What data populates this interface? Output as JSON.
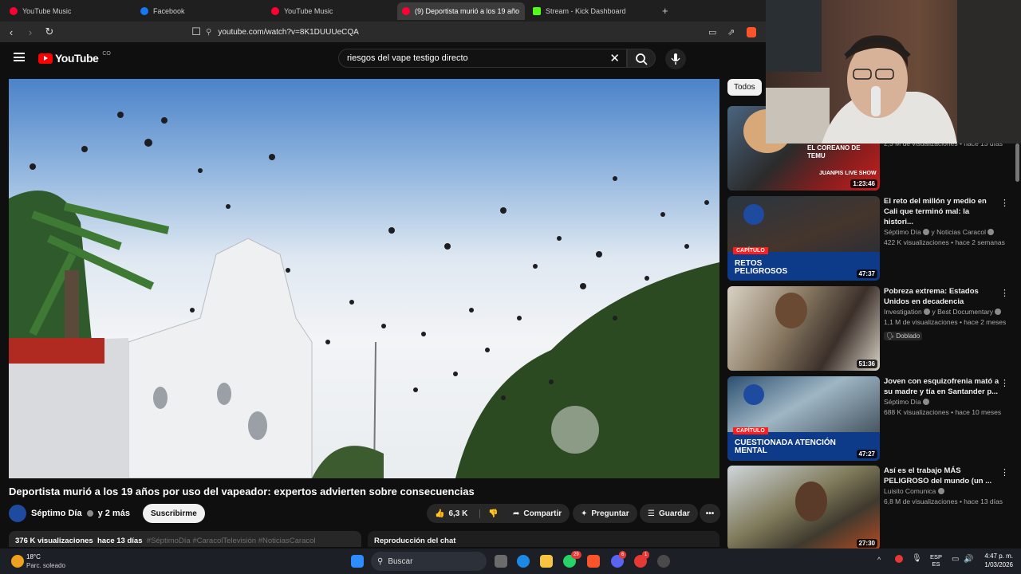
{
  "browser": {
    "tabs": [
      {
        "label": "YouTube Music",
        "color": "#ff0033",
        "active": false
      },
      {
        "label": "Facebook",
        "color": "#1877f2",
        "active": false
      },
      {
        "label": "YouTube Music",
        "color": "#ff0033",
        "active": false
      },
      {
        "label": "(9) Deportista murió a los 19 año",
        "color": "#ff0033",
        "active": true
      },
      {
        "label": "Stream - Kick Dashboard",
        "color": "#53fc18",
        "active": false
      }
    ],
    "url": "youtube.com/watch?v=8K1DUUUeCQA"
  },
  "youtube": {
    "logo_text": "YouTube",
    "country_code": "CO",
    "search_query": "riesgos del vape testigo directo",
    "video": {
      "title": "Deportista murió a los 19 años por uso del vapeador: expertos advierten sobre consecuencias",
      "channel": "Séptimo Día",
      "channel_extra": "y 2 más",
      "subscribe_label": "Suscribirme",
      "likes": "6,3 K",
      "share_label": "Compartir",
      "ask_label": "Preguntar",
      "save_label": "Guardar",
      "views": "376 K visualizaciones",
      "age": "hace 13 días",
      "hashtags": "#SéptimoDía #CaracolTelevisión #NoticiasCaracol",
      "chat_replay": "Reproducción del chat"
    },
    "chip_all": "Todos",
    "partial_top_meta": "2,3 M de visualizaciones • hace 13 días",
    "recommendations": [
      {
        "title": "",
        "channel": "",
        "meta": "",
        "duration": "1:23:46",
        "thumb_text": "EL COREANO DE TEMU",
        "thumb_sub": "JUANPIS LIVE SHOW"
      },
      {
        "title": "El reto del millón y medio en Cali que terminó mal: la histori...",
        "channel": "Séptimo Día",
        "channel_extra": "y Noticias Caracol",
        "meta": "422 K visualizaciones • hace 2 semanas",
        "duration": "47:37",
        "thumb_tag": "CAPÍTULO",
        "thumb_text": "RETOS PELIGROSOS"
      },
      {
        "title": "Pobreza extrema: Estados Unidos en decadencia",
        "channel": "Investigation",
        "channel_extra": "y Best Documentary",
        "meta": "1,1 M de visualizaciones • hace 2 meses",
        "badge": "Doblado",
        "duration": "51:36"
      },
      {
        "title": "Joven con esquizofrenia mató a su madre y tía en Santander p...",
        "channel": "Séptimo Día",
        "meta": "688 K visualizaciones • hace 10 meses",
        "duration": "47:27",
        "thumb_tag": "CAPÍTULO",
        "thumb_text": "CUESTIONADA ATENCIÓN MENTAL"
      },
      {
        "title": "Así es el trabajo MÁS PELIGROSO del mundo (un ...",
        "channel": "Luisito Comunica",
        "meta": "6,8 M de visualizaciones • hace 13 días",
        "duration": "27:30"
      }
    ]
  },
  "taskbar": {
    "weather_temp": "18°C",
    "weather_desc": "Parc. soleado",
    "search_label": "Buscar",
    "lang": "ESP",
    "lang_sub": "ES",
    "time": "4:47 p. m.",
    "date": "1/03/2026",
    "badges": [
      "29",
      "6",
      "1"
    ]
  }
}
